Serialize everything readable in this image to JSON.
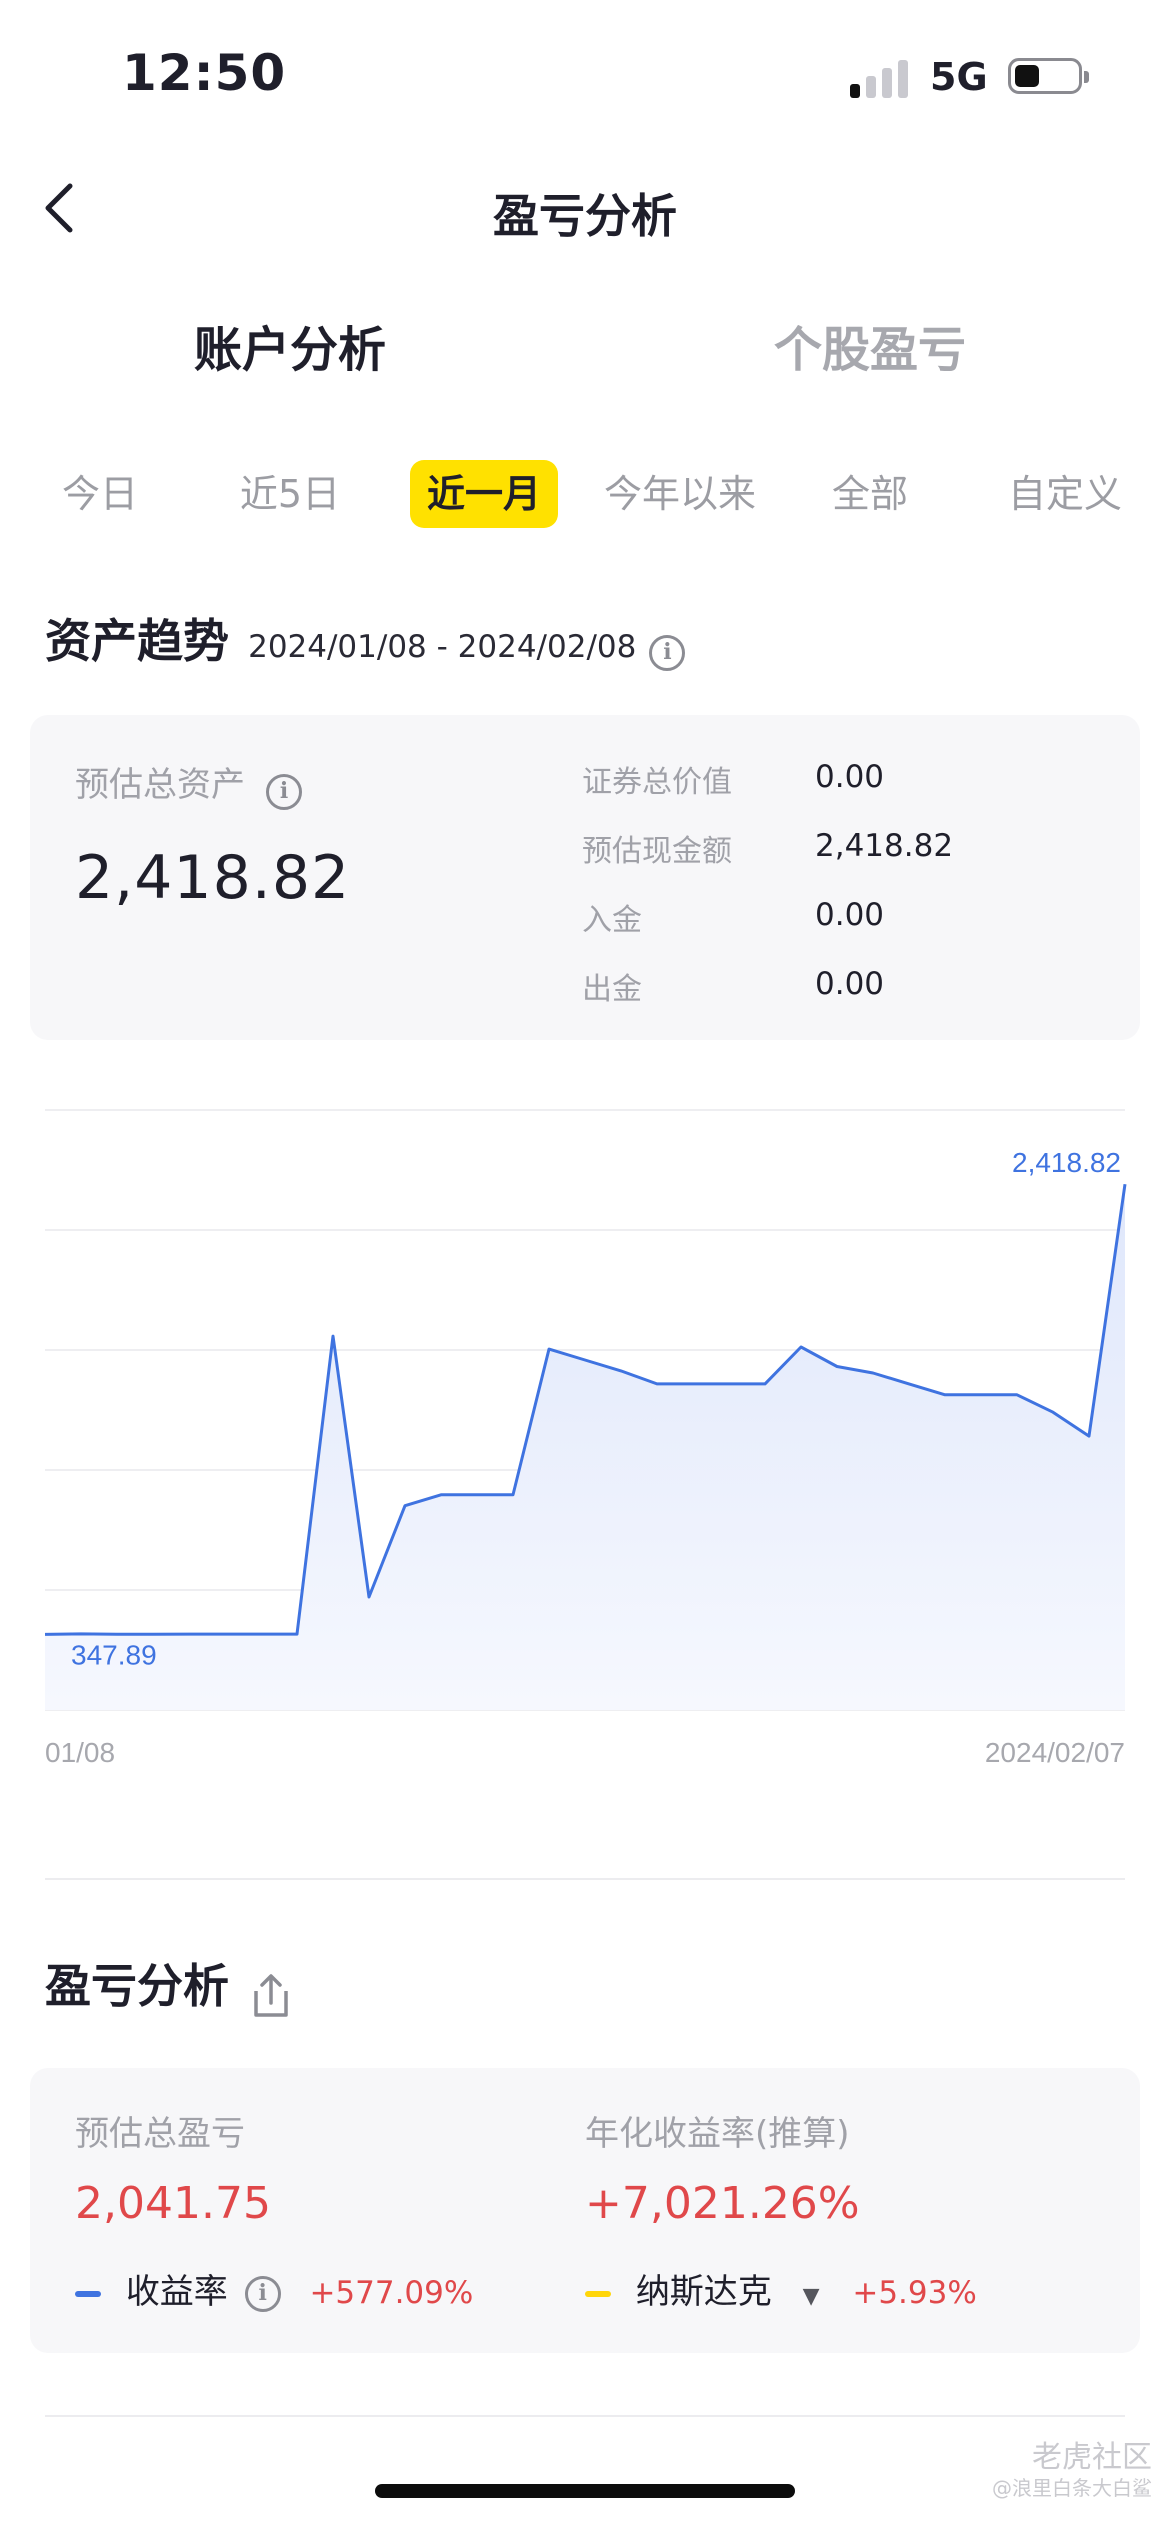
{
  "status": {
    "time": "12:50",
    "network": "5G"
  },
  "nav": {
    "title": "盈亏分析"
  },
  "main_tabs": [
    {
      "label": "账户分析",
      "active": true
    },
    {
      "label": "个股盈亏",
      "active": false
    }
  ],
  "period_tabs": [
    {
      "label": "今日",
      "active": false
    },
    {
      "label": "近5日",
      "active": false
    },
    {
      "label": "近一月",
      "active": true
    },
    {
      "label": "今年以来",
      "active": false
    },
    {
      "label": "全部",
      "active": false
    },
    {
      "label": "自定义",
      "active": false
    }
  ],
  "asset_section": {
    "title": "资产趋势",
    "range": "2024/01/08 - 2024/02/08"
  },
  "asset_card": {
    "total_label": "预估总资产",
    "total_value": "2,418.82",
    "rows": [
      {
        "label": "证券总价值",
        "value": "0.00"
      },
      {
        "label": "预估现金额",
        "value": "2,418.82"
      },
      {
        "label": "入金",
        "value": "0.00"
      },
      {
        "label": "出金",
        "value": "0.00"
      }
    ]
  },
  "chart_data": {
    "type": "area",
    "x_start_label": "01/08",
    "x_end_label": "2024/02/07",
    "min_label": "347.89",
    "max_label": "2,418.82",
    "values": [
      347.89,
      350,
      348,
      348,
      349,
      349,
      349,
      349,
      1720,
      520,
      940,
      990,
      990,
      990,
      1660,
      1610,
      1560,
      1500,
      1500,
      1500,
      1500,
      1670,
      1580,
      1550,
      1500,
      1450,
      1450,
      1450,
      1370,
      1260,
      2418.82
    ],
    "color": "#3f73e0",
    "fill": "#e9effd",
    "ylim": [
      0,
      2760
    ],
    "grid": true
  },
  "pl_section": {
    "title": "盈亏分析"
  },
  "pl_card": {
    "total_label": "预估总盈亏",
    "total_value": "2,041.75",
    "annual_label": "年化收益率(推算)",
    "annual_value": "+7,021.26%",
    "return_label": "收益率",
    "return_value": "+577.09%",
    "benchmark_label": "纳斯达克",
    "benchmark_value": "+5.93%",
    "return_color": "#3f73e0",
    "benchmark_color": "#ffd60a"
  },
  "watermark": {
    "line1": "老虎社区",
    "line2": "@浪里白条大白鲨"
  }
}
